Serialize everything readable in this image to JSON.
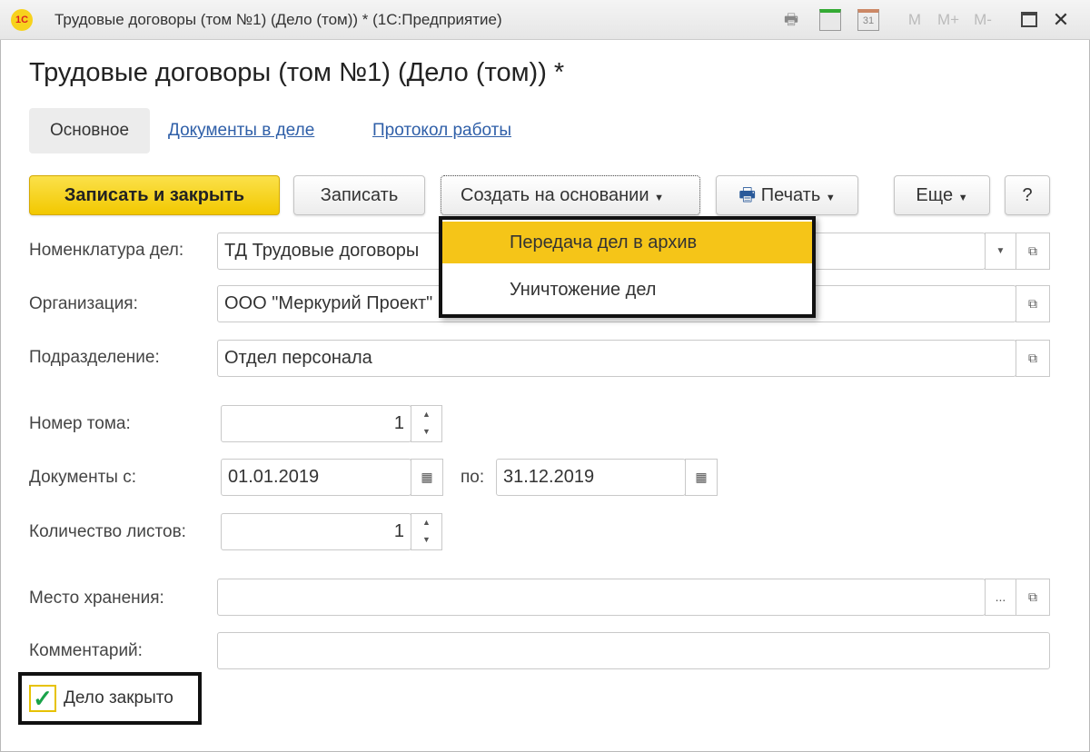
{
  "window": {
    "logo": "1С",
    "title": "Трудовые договоры (том №1) (Дело (том)) *  (1С:Предприятие)",
    "icons": [
      "print-preview-icon",
      "calculator-icon",
      "calendar-icon"
    ],
    "memory_buttons": [
      "M",
      "M+",
      "M-"
    ],
    "calendar_day": "31"
  },
  "page_title": "Трудовые договоры (том №1) (Дело (том)) *",
  "tabs": [
    "Основное",
    "Документы в деле",
    "Протокол работы"
  ],
  "toolbar": {
    "save_close": "Записать и закрыть",
    "save": "Записать",
    "create_based": "Создать на основании",
    "print": "Печать",
    "more": "Еще",
    "help": "?"
  },
  "menu": {
    "items": [
      "Передача дел в архив",
      "Уничтожение дел"
    ]
  },
  "form": {
    "nomenclature": {
      "label": "Номенклатура дел:",
      "value": "ТД Трудовые договоры"
    },
    "organization": {
      "label": "Организация:",
      "value": "ООО \"Меркурий Проект\""
    },
    "department": {
      "label": "Подразделение:",
      "value": "Отдел персонала"
    },
    "volume": {
      "label": "Номер тома:",
      "value": "1"
    },
    "docs_from": {
      "label": "Документы с:",
      "value": "01.01.2019"
    },
    "docs_to": {
      "label": "по:",
      "value": "31.12.2019"
    },
    "sheets": {
      "label": "Количество листов:",
      "value": "1"
    },
    "storage": {
      "label": "Место хранения:",
      "value": "",
      "more": "..."
    },
    "comment": {
      "label": "Комментарий:",
      "value": ""
    },
    "closed": {
      "label": "Дело закрыто",
      "checked": true
    }
  }
}
